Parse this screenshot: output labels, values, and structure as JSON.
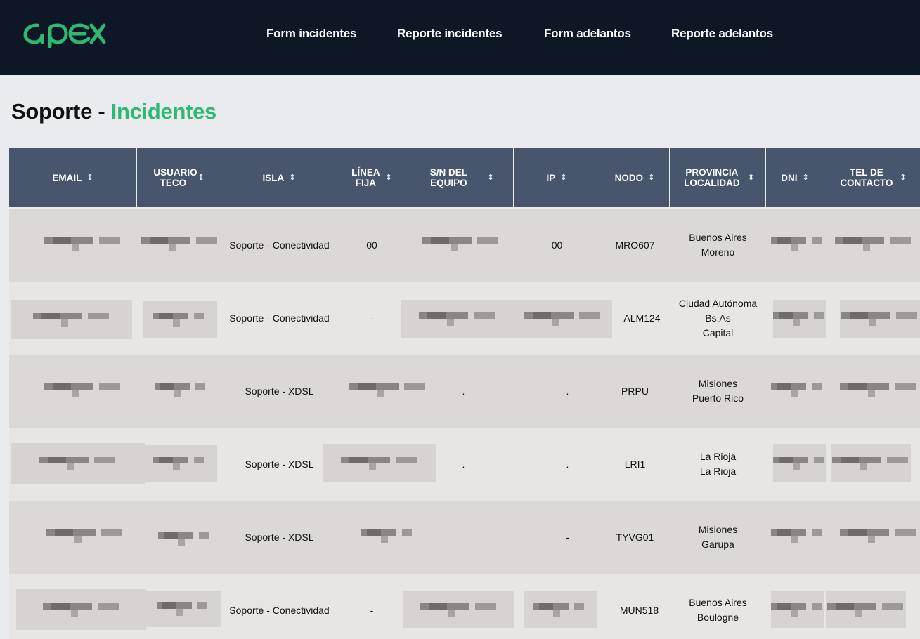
{
  "brand": {
    "logo_text": "apex",
    "logo_color": "#2eb872"
  },
  "nav": {
    "items": [
      {
        "label": "Form incidentes"
      },
      {
        "label": "Reporte incidentes"
      },
      {
        "label": "Form adelantos"
      },
      {
        "label": "Reporte adelantos"
      }
    ]
  },
  "page": {
    "title_prefix": "Soporte - ",
    "title_accent": "Incidentes",
    "accent_color": "#2eb872"
  },
  "table": {
    "sort_glyph": "⇕",
    "columns": [
      {
        "label": "EMAIL"
      },
      {
        "label": "USUARIO TECO"
      },
      {
        "label": "ISLA"
      },
      {
        "label": "LÍNEA FIJA"
      },
      {
        "label": "S/N DEL EQUIPO"
      },
      {
        "label": "IP"
      },
      {
        "label": "NODO"
      },
      {
        "label": "PROVINCIA LOCALIDAD"
      },
      {
        "label": "DNI"
      },
      {
        "label": "TEL DE CONTACTO"
      }
    ],
    "rows": [
      {
        "isla": "Soporte - Conectividad",
        "linea_fija": "00",
        "ip": "00",
        "nodo": "MRO607",
        "provincia": [
          "Buenos Aires",
          "Moreno"
        ]
      },
      {
        "isla": "Soporte - Conectividad",
        "linea_fija": "-",
        "ip": "",
        "nodo": "ALM124",
        "provincia": [
          "Ciudad Autónoma",
          "Bs.As",
          "Capital"
        ]
      },
      {
        "isla": "Soporte - XDSL",
        "linea_fija": "",
        "sn": ".",
        "ip": ".",
        "nodo": "PRPU",
        "provincia": [
          "Misiones",
          "Puerto Rico"
        ]
      },
      {
        "isla": "Soporte - XDSL",
        "linea_fija": "",
        "sn": ".",
        "ip": ".",
        "nodo": "LRI1",
        "provincia": [
          "La Rioja",
          "La Rioja"
        ]
      },
      {
        "isla": "Soporte - XDSL",
        "linea_fija": "",
        "sn": "",
        "ip": "-",
        "nodo": "TYVG01",
        "provincia": [
          "Misiones",
          "Garupa"
        ]
      },
      {
        "isla": "Soporte - Conectividad",
        "linea_fija": "-",
        "ip": "",
        "nodo": "MUN518",
        "provincia": [
          "Buenos Aires",
          "Boulogne"
        ]
      }
    ]
  }
}
